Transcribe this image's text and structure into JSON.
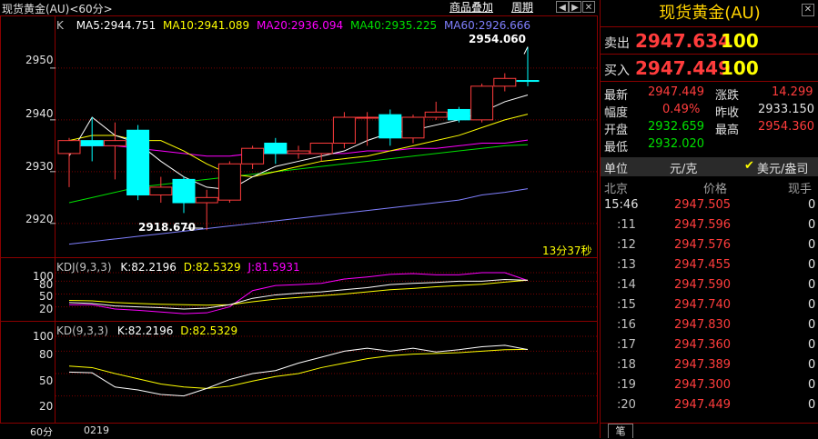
{
  "toolbar": {
    "title": "现货黄金(AU)<60分>",
    "overlay_btn": "商品叠加",
    "period_btn": "周期",
    "icons": [
      "prev-icon",
      "next-icon",
      "close-icon"
    ]
  },
  "main_chart": {
    "k_label": "K",
    "ma_items": [
      {
        "label": "MA5:2944.751",
        "color": "#ffffff"
      },
      {
        "label": "MA10:2941.089",
        "color": "#ffff00"
      },
      {
        "label": "MA20:2936.094",
        "color": "#ff00ff"
      },
      {
        "label": "MA40:2935.225",
        "color": "#00e000"
      },
      {
        "label": "MA60:2926.666",
        "color": "#8080ff"
      }
    ],
    "price_ticks": [
      "2950",
      "2940",
      "2930",
      "2920"
    ],
    "high_note": "2954.060",
    "low_note": "2918.670",
    "countdown": "13分37秒"
  },
  "chart_data": {
    "type": "candlestick",
    "y_range": [
      2914,
      2957
    ],
    "candles": [
      {
        "o": 2933.5,
        "h": 2936.5,
        "l": 2927.0,
        "c": 2936.0
      },
      {
        "o": 2936.0,
        "h": 2940.5,
        "l": 2932.0,
        "c": 2935.0
      },
      {
        "o": 2935.0,
        "h": 2939.5,
        "l": 2928.5,
        "c": 2936.0
      },
      {
        "o": 2938.0,
        "h": 2939.0,
        "l": 2924.5,
        "c": 2925.5
      },
      {
        "o": 2925.5,
        "h": 2929.0,
        "l": 2924.0,
        "c": 2927.0
      },
      {
        "o": 2928.5,
        "h": 2929.0,
        "l": 2922.0,
        "c": 2924.0
      },
      {
        "o": 2924.0,
        "h": 2926.5,
        "l": 2918.7,
        "c": 2925.0
      },
      {
        "o": 2924.5,
        "h": 2932.0,
        "l": 2924.0,
        "c": 2931.5
      },
      {
        "o": 2931.5,
        "h": 2935.0,
        "l": 2930.5,
        "c": 2934.5
      },
      {
        "o": 2935.5,
        "h": 2936.5,
        "l": 2931.5,
        "c": 2933.5
      },
      {
        "o": 2933.5,
        "h": 2935.0,
        "l": 2932.5,
        "c": 2934.0
      },
      {
        "o": 2933.5,
        "h": 2935.5,
        "l": 2932.0,
        "c": 2935.5
      },
      {
        "o": 2935.5,
        "h": 2941.5,
        "l": 2934.5,
        "c": 2940.5
      },
      {
        "o": 2940.5,
        "h": 2941.5,
        "l": 2935.0,
        "c": 2940.5
      },
      {
        "o": 2941.0,
        "h": 2942.0,
        "l": 2935.0,
        "c": 2936.5
      },
      {
        "o": 2936.5,
        "h": 2941.0,
        "l": 2935.5,
        "c": 2940.5
      },
      {
        "o": 2940.5,
        "h": 2943.5,
        "l": 2940.0,
        "c": 2941.5
      },
      {
        "o": 2942.0,
        "h": 2942.5,
        "l": 2939.5,
        "c": 2940.0
      },
      {
        "o": 2940.0,
        "h": 2947.0,
        "l": 2939.5,
        "c": 2946.5
      },
      {
        "o": 2946.5,
        "h": 2949.0,
        "l": 2945.5,
        "c": 2948.0
      },
      {
        "o": 2947.6,
        "h": 2954.1,
        "l": 2946.5,
        "c": 2947.5
      }
    ],
    "ma5": [
      2933,
      2940.5,
      2937,
      2935.5,
      2932,
      2929,
      2927,
      2926.5,
      2929,
      2931,
      2932,
      2933,
      2934,
      2936,
      2937.5,
      2938,
      2939,
      2940,
      2941.5,
      2943.5,
      2944.8
    ],
    "ma10": [
      2936,
      2937,
      2937,
      2936,
      2936,
      2934,
      2931.5,
      2929.5,
      2929,
      2930,
      2931,
      2932,
      2932.5,
      2933,
      2934,
      2935,
      2936,
      2937,
      2938.5,
      2940,
      2941.1
    ],
    "ma20": [
      2935,
      2935,
      2935,
      2934.5,
      2934,
      2933.5,
      2933,
      2933,
      2933.5,
      2933.5,
      2933.5,
      2933.5,
      2933.5,
      2934,
      2934,
      2934.5,
      2934.5,
      2935,
      2935.5,
      2935.5,
      2936.1
    ],
    "ma40": [
      2924,
      2925,
      2926,
      2927,
      2927.5,
      2928,
      2928.5,
      2929,
      2929.5,
      2930,
      2930.5,
      2931,
      2931.5,
      2932,
      2932.5,
      2933,
      2933.5,
      2934,
      2934.5,
      2935,
      2935.2
    ],
    "ma60": [
      2916,
      2916.5,
      2917,
      2917.5,
      2918,
      2918.5,
      2919,
      2919.5,
      2920,
      2920.5,
      2921,
      2921.5,
      2922,
      2922.5,
      2923,
      2923.5,
      2924,
      2924.5,
      2925.5,
      2926,
      2926.7
    ],
    "kdj": {
      "k": [
        30,
        28,
        22,
        20,
        18,
        15,
        17,
        25,
        40,
        48,
        52,
        55,
        60,
        65,
        72,
        75,
        77,
        80,
        80,
        84,
        82.2
      ],
      "d": [
        35,
        34,
        30,
        28,
        26,
        25,
        24,
        25,
        32,
        38,
        42,
        46,
        50,
        55,
        60,
        63,
        67,
        70,
        73,
        78,
        82.5
      ],
      "j": [
        25,
        25,
        15,
        12,
        8,
        4,
        6,
        20,
        58,
        70,
        72,
        75,
        85,
        90,
        96,
        98,
        95,
        95,
        100,
        100,
        81.6
      ]
    },
    "kd": {
      "k": [
        52,
        51,
        32,
        28,
        22,
        20,
        30,
        42,
        50,
        54,
        64,
        72,
        80,
        84,
        80,
        84,
        79,
        82,
        86,
        88,
        82.2
      ],
      "d": [
        60,
        58,
        50,
        43,
        36,
        32,
        30,
        33,
        40,
        46,
        50,
        58,
        64,
        70,
        74,
        76,
        77,
        78,
        80,
        82,
        82.5
      ]
    }
  },
  "kdj_panel": {
    "title": "KDJ(9,3,3)",
    "k": "K:82.2196",
    "d": "D:82.5329",
    "j": "J:81.5931",
    "ticks": [
      "100",
      "80",
      "50",
      "20"
    ]
  },
  "kd_panel": {
    "title": "KD(9,3,3)",
    "k": "K:82.2196",
    "d": "D:82.5329",
    "ticks": [
      "100",
      "80",
      "50",
      "20"
    ]
  },
  "axis": {
    "period": "60分",
    "date": "0219"
  },
  "quote": {
    "title": "现货黄金(AU)",
    "sell_label": "卖出",
    "sell_price": "2947.634",
    "sell_vol": "100",
    "buy_label": "买入",
    "buy_price": "2947.449",
    "buy_vol": "100",
    "rows": [
      {
        "l1": "最新",
        "v1": "2947.449",
        "c1": "red",
        "l2": "涨跌",
        "v2": "14.299",
        "c2": "red"
      },
      {
        "l1": "幅度",
        "v1": "0.49%",
        "c1": "red",
        "l2": "昨收",
        "v2": "2933.150",
        "c2": "wht"
      },
      {
        "l1": "开盘",
        "v1": "2932.659",
        "c1": "grn",
        "l2": "最高",
        "v2": "2954.360",
        "c2": "red"
      },
      {
        "l1": "最低",
        "v1": "2932.020",
        "c1": "grn",
        "l2": "",
        "v2": "",
        "c2": "wht"
      }
    ],
    "unit_label": "单位",
    "unit_value": "元/克",
    "unit_option": "美元/盎司",
    "ticks_header": {
      "time": "北京",
      "price": "价格",
      "hand": "现手"
    },
    "ticks": [
      {
        "t": "15:46",
        "p": "2947.505",
        "h": "0"
      },
      {
        "t": ":11",
        "p": "2947.596",
        "h": "0"
      },
      {
        "t": ":12",
        "p": "2947.576",
        "h": "0"
      },
      {
        "t": ":13",
        "p": "2947.455",
        "h": "0"
      },
      {
        "t": ":14",
        "p": "2947.590",
        "h": "0"
      },
      {
        "t": ":15",
        "p": "2947.740",
        "h": "0"
      },
      {
        "t": ":16",
        "p": "2947.830",
        "h": "0"
      },
      {
        "t": ":17",
        "p": "2947.360",
        "h": "0"
      },
      {
        "t": ":18",
        "p": "2947.389",
        "h": "0"
      },
      {
        "t": ":19",
        "p": "2947.300",
        "h": "0"
      },
      {
        "t": ":20",
        "p": "2947.449",
        "h": "0"
      }
    ],
    "tab": "笔"
  }
}
